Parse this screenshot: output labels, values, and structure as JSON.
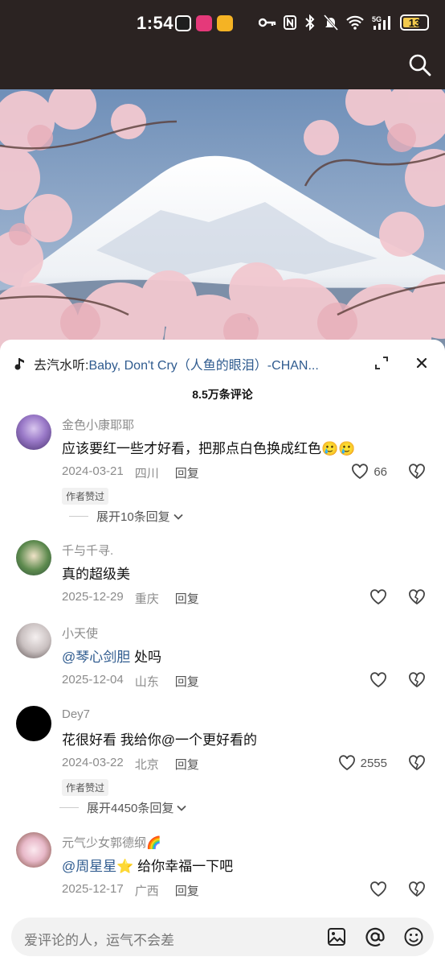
{
  "status": {
    "time": "1:54",
    "network": "5G",
    "battery": "13"
  },
  "music": {
    "prefix": "去汽水听: ",
    "title": "Baby, Don't Cry（人鱼的眼泪）-CHAN..."
  },
  "comment_count_title": "8.5万条评论",
  "comments": [
    {
      "name": "金色小康耶耶",
      "text": "应该要红一些才好看，把那点白色换成红色🥲🥲",
      "date": "2024-03-21",
      "region": "四川",
      "reply_label": "回复",
      "likes": "66",
      "author_tag": "作者赞过",
      "expand_label": "展开10条回复"
    },
    {
      "name": "千与千寻.",
      "text": "真的超级美",
      "date": "2025-12-29",
      "region": "重庆",
      "reply_label": "回复"
    },
    {
      "name": "小天使",
      "mention": "@琴心剑胆",
      "text": " 处吗",
      "date": "2025-12-04",
      "region": "山东",
      "reply_label": "回复"
    },
    {
      "name": "Dey7",
      "text": "花很好看 我给你@一个更好看的",
      "date": "2024-03-22",
      "region": "北京",
      "reply_label": "回复",
      "likes": "2555",
      "author_tag": "作者赞过",
      "expand_label": "展开4450条回复"
    },
    {
      "name": "元气少女郭德纲🌈",
      "mention": "@周星星⭐",
      "text": " 给你幸福一下吧",
      "date": "2025-12-17",
      "region": "广西",
      "reply_label": "回复"
    }
  ],
  "input": {
    "placeholder": "爱评论的人，运气不会差"
  },
  "icons": {
    "search": "search-icon",
    "music_note": "music-note-icon",
    "expand": "expand-icon",
    "close": "close-icon",
    "like": "heart-icon",
    "dislike": "broken-heart-icon",
    "image": "image-icon",
    "mention": "at-icon",
    "emoji": "emoji-icon"
  },
  "colors": {
    "accent_link": "#2f5b8f",
    "status_bg": "#2b2322"
  }
}
